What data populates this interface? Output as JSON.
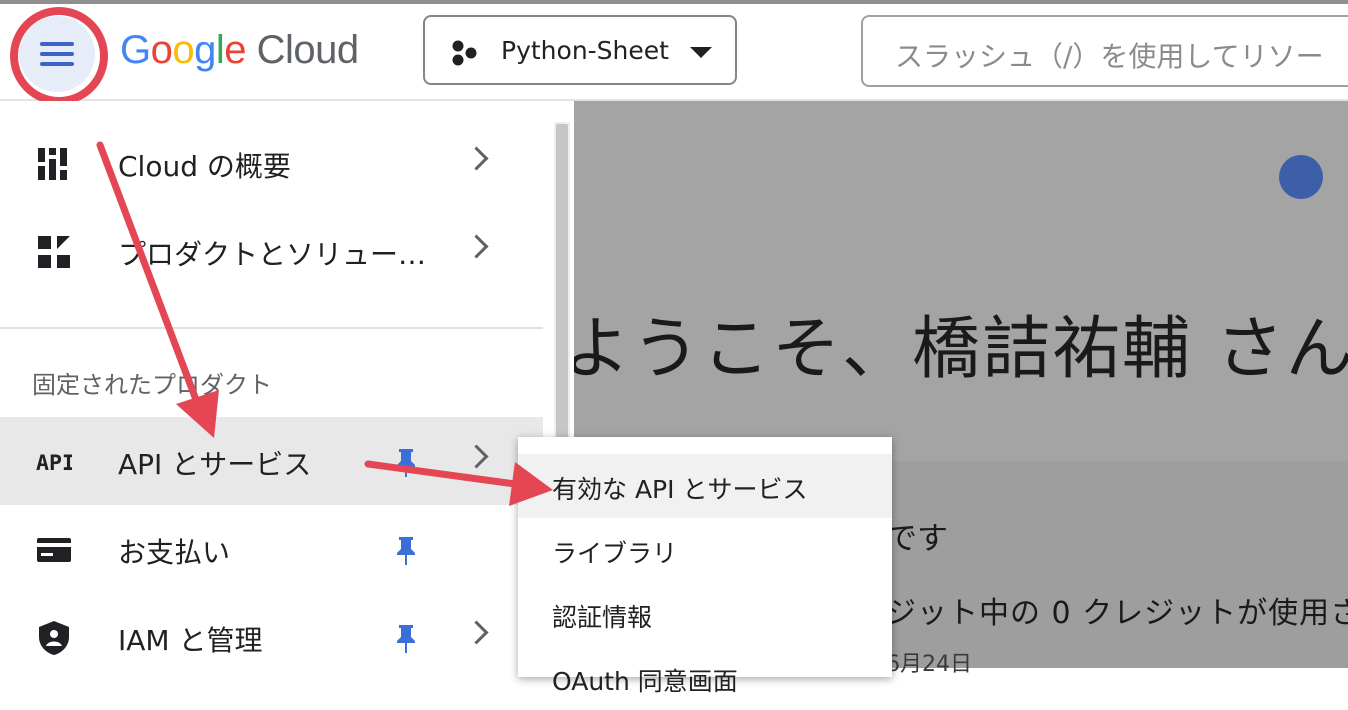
{
  "header": {
    "menu_icon": "hamburger-menu-icon",
    "logo_google": "Google",
    "logo_cloud": "Cloud",
    "project_name": "Python-Sheet",
    "search_placeholder": "スラッシュ（/）を使用してリソー"
  },
  "main": {
    "welcome": "ようこそ、橋詰祐輔 さん",
    "card_line_1": "です",
    "card_line_2": "ジット中の 0 クレジットが使用さ",
    "card_line_3": "6月24日"
  },
  "nav": {
    "items": [
      {
        "label": "Cloud の概要",
        "icon": "dashboard-icon"
      },
      {
        "label": "プロダクトとソリュー…",
        "icon": "grid-icon"
      }
    ],
    "section_label": "固定されたプロダクト",
    "pinned": [
      {
        "label": "API とサービス",
        "icon": "api-icon",
        "pinned": true,
        "has_submenu": true
      },
      {
        "label": "お支払い",
        "icon": "billing-icon",
        "pinned": true,
        "has_submenu": false
      },
      {
        "label": "IAM と管理",
        "icon": "shield-icon",
        "pinned": true,
        "has_submenu": true
      }
    ]
  },
  "submenu": {
    "items": [
      "有効な API とサービス",
      "ライブラリ",
      "認証情報",
      "OAuth 同意画面"
    ]
  },
  "colors": {
    "accent_blue": "#3c64c8",
    "annotation_red": "#e44653",
    "pin_blue": "#3a6fd8"
  }
}
